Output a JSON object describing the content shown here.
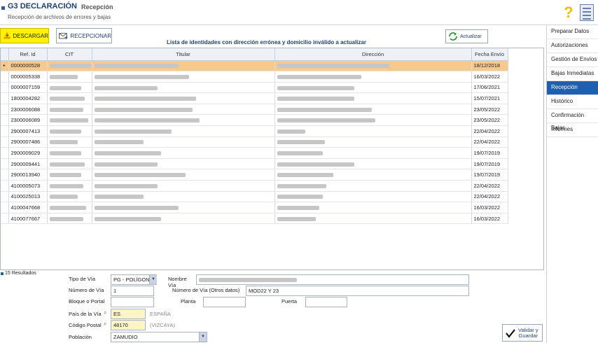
{
  "header": {
    "app_title": "G3 DECLARACIÓN",
    "section_name": "Recepción",
    "subtitle": "Recepción de archivos de errores y bajas"
  },
  "sidebar": {
    "items": [
      {
        "label": "Preparar Datos",
        "active": false
      },
      {
        "label": "Autorizaciones",
        "active": false
      },
      {
        "label": "Gestión de Envíos",
        "active": false
      },
      {
        "label": "Bajas Inmediatas",
        "active": false
      },
      {
        "label": "Recepción",
        "active": true
      },
      {
        "label": "Histórico",
        "active": false
      },
      {
        "label": "Confirmación Bajas",
        "active": false
      },
      {
        "label": "Informes",
        "active": false
      }
    ]
  },
  "toolbar": {
    "descargar_label": "DESCARGAR",
    "recepcionar_label": "RECEPCIONAR",
    "list_title": "Lista de identidades con dirección errónea y domicilio inválido a actualizar",
    "actualizar_label": "Actualizar"
  },
  "grid": {
    "headers": [
      "Ref. Id",
      "CIT",
      "Titular",
      "Dirección",
      "Fecha Envío"
    ],
    "rows": [
      {
        "ref": "0000000528",
        "fecha": "18/12/2018"
      },
      {
        "ref": "0000005338",
        "fecha": "16/03/2022"
      },
      {
        "ref": "0000007159",
        "fecha": "17/06/2021"
      },
      {
        "ref": "1800004282",
        "fecha": "15/07/2021"
      },
      {
        "ref": "2300006088",
        "fecha": "23/05/2022"
      },
      {
        "ref": "2300006089",
        "fecha": "23/05/2022"
      },
      {
        "ref": "2900007413",
        "fecha": "22/04/2022"
      },
      {
        "ref": "2900007486",
        "fecha": "22/04/2022"
      },
      {
        "ref": "2900009029",
        "fecha": "19/07/2019"
      },
      {
        "ref": "2900009441",
        "fecha": "19/07/2019"
      },
      {
        "ref": "2900013940",
        "fecha": "19/07/2019"
      },
      {
        "ref": "4100005073",
        "fecha": "22/04/2022"
      },
      {
        "ref": "4100025013",
        "fecha": "22/04/2022"
      },
      {
        "ref": "4100047668",
        "fecha": "16/03/2022"
      },
      {
        "ref": "4100077667",
        "fecha": "16/03/2022"
      }
    ]
  },
  "form": {
    "results_label": "15 Resultados",
    "tipo_via_label": "Tipo de Vía",
    "tipo_via_value": "PG - POLÍGONC",
    "nombre_via_label": "Nombre Vía",
    "numero_via_label": "Número de Vía",
    "numero_via_value": "1",
    "numero_via_otros_label": "Número de Vía (Otros datos)",
    "numero_via_otros_value": "MOD22 Y 23",
    "bloque_label": "Bloque o Portal",
    "planta_label": "Planta",
    "puerta_label": "Puerta",
    "pais_label": "País de la Vía",
    "pais_value": "ES",
    "pais_name": "ESPAÑA",
    "cp_label": "Código Postal",
    "cp_value": "48170",
    "cp_region": "(VIZCAYA)",
    "poblacion_label": "Población",
    "poblacion_value": "ZAMUDIO",
    "validar_label_1": "Validar y",
    "validar_label_2": "Guardar"
  }
}
